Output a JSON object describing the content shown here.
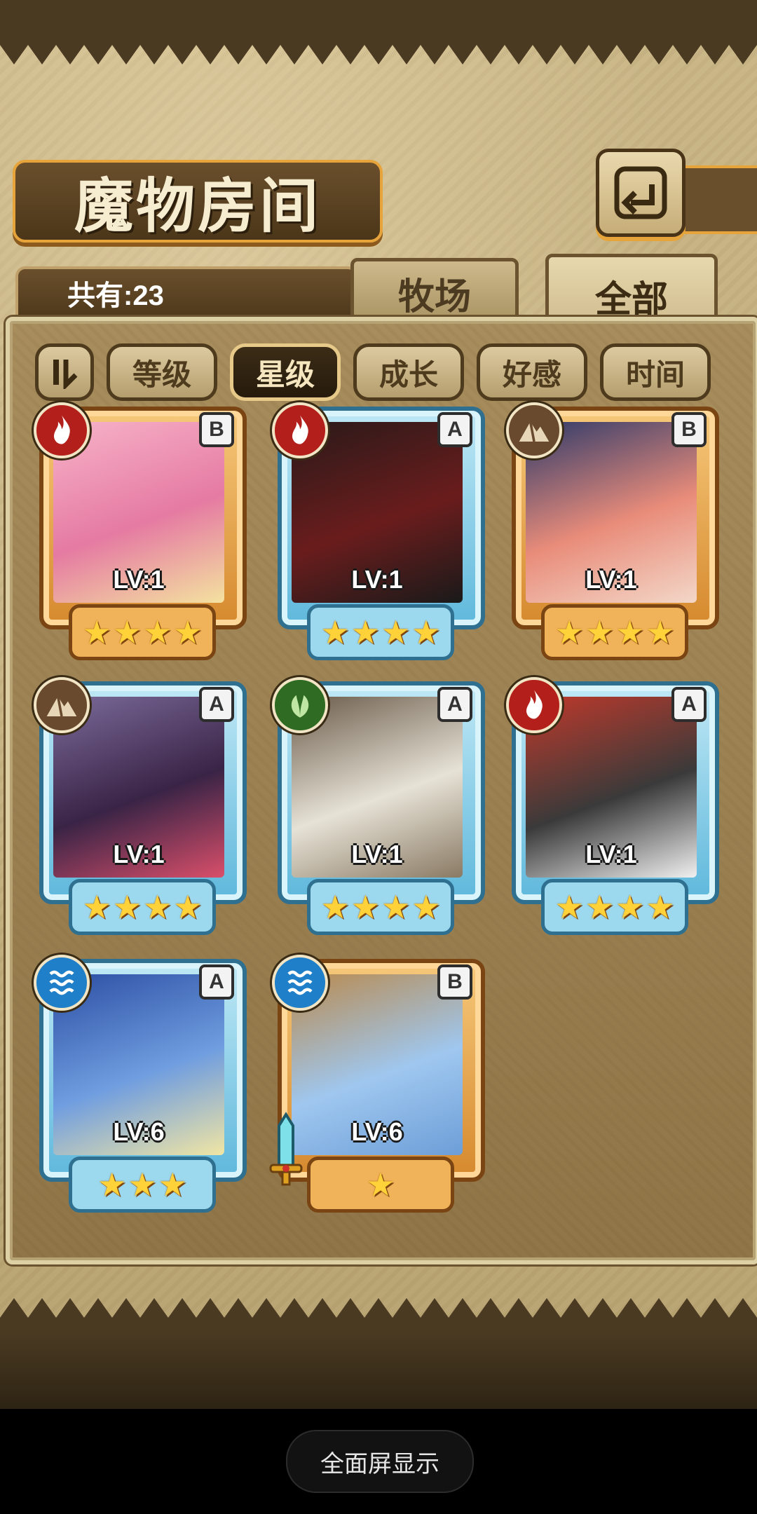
{
  "header": {
    "title": "魔物房间"
  },
  "summary": {
    "count_text": "共有:23"
  },
  "tabs": [
    {
      "label": "牧场",
      "active": false
    },
    {
      "label": "全部",
      "active": true
    }
  ],
  "sort": {
    "toggle_icon": "sort-toggle-icon",
    "options": [
      {
        "label": "等级",
        "active": false
      },
      {
        "label": "星级",
        "active": true
      },
      {
        "label": "成长",
        "active": false
      },
      {
        "label": "好感",
        "active": false
      },
      {
        "label": "时间",
        "active": false
      }
    ]
  },
  "monsters": [
    {
      "element": "fire",
      "rank": "B",
      "level": "LV:1",
      "stars": 4
    },
    {
      "element": "fire",
      "rank": "A",
      "level": "LV:1",
      "stars": 4
    },
    {
      "element": "earth",
      "rank": "B",
      "level": "LV:1",
      "stars": 4
    },
    {
      "element": "earth",
      "rank": "A",
      "level": "LV:1",
      "stars": 4
    },
    {
      "element": "wood",
      "rank": "A",
      "level": "LV:1",
      "stars": 4
    },
    {
      "element": "fire",
      "rank": "A",
      "level": "LV:1",
      "stars": 4
    },
    {
      "element": "water",
      "rank": "A",
      "level": "LV:6",
      "stars": 3
    },
    {
      "element": "water",
      "rank": "B",
      "level": "LV:6",
      "stars": 1,
      "equipped": "sword-icon"
    }
  ],
  "colors": {
    "fire": "#b3201c",
    "earth": "#6a4a2e",
    "wood": "#2f6b22",
    "water": "#1f7fc8"
  },
  "system": {
    "fullscreen_label": "全面屏显示"
  }
}
